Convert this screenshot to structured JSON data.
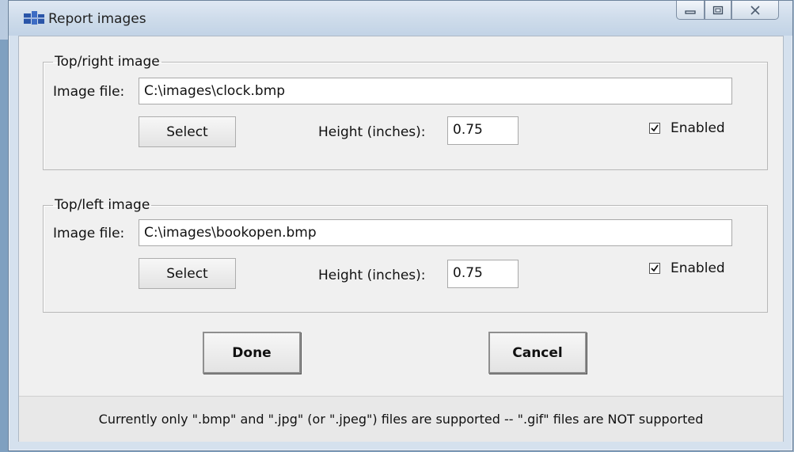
{
  "window": {
    "title": "Report images"
  },
  "top_right": {
    "legend": "Top/right image",
    "file_label": "Image file:",
    "file_value": "C:\\images\\clock.bmp",
    "select_label": "Select",
    "height_label": "Height (inches):",
    "height_value": "0.75",
    "enabled_label": "Enabled",
    "enabled_checked": true
  },
  "top_left": {
    "legend": "Top/left image",
    "file_label": "Image file:",
    "file_value": "C:\\images\\bookopen.bmp",
    "select_label": "Select",
    "height_label": "Height (inches):",
    "height_value": "0.75",
    "enabled_label": "Enabled",
    "enabled_checked": true
  },
  "actions": {
    "done_label": "Done",
    "cancel_label": "Cancel"
  },
  "status": {
    "text": "Currently only \".bmp\" and \".jpg\" (or \".jpeg\") files are supported -- \".gif\" files are NOT supported"
  },
  "colors": {
    "titlebar": "#cddbea",
    "client": "#f0f0f0",
    "status_bar": "#e8e8e8"
  },
  "icons": [
    "app-icon",
    "minimize-icon",
    "maximize-icon",
    "close-icon",
    "checkbox-checked-icon"
  ]
}
